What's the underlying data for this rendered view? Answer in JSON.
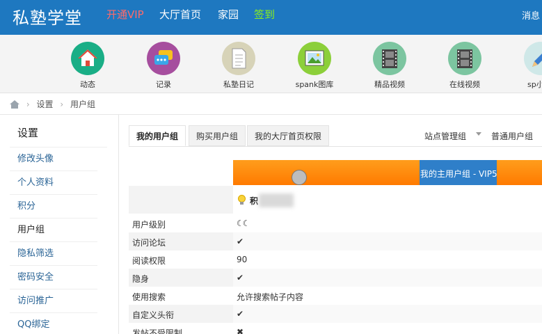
{
  "header": {
    "logo": "私塾学堂",
    "nav": {
      "vip": "开通VIP",
      "hall": "大厅首页",
      "home": "家园",
      "checkin": "签到",
      "messages": "消息"
    }
  },
  "iconbar": {
    "items": [
      {
        "label": "动态",
        "icon": "house-icon",
        "color": "#1aae86"
      },
      {
        "label": "记录",
        "icon": "chat-bubble-icon",
        "color": "#a64e9e"
      },
      {
        "label": "私塾日记",
        "icon": "document-icon",
        "color": "#d7d3b8"
      },
      {
        "label": "spank图库",
        "icon": "picture-icon",
        "color": "#8ccf3a"
      },
      {
        "label": "精品视频",
        "icon": "film-icon",
        "color": "#7cc5a0"
      },
      {
        "label": "在线视频",
        "icon": "film-icon",
        "color": "#7cc5a0"
      },
      {
        "label": "sp小",
        "icon": "pencil-icon",
        "color": "#cfe8e8"
      }
    ]
  },
  "breadcrumb": {
    "items": [
      "设置",
      "用户组"
    ]
  },
  "sidebar": {
    "title": "设置",
    "items": [
      {
        "label": "修改头像"
      },
      {
        "label": "个人资料"
      },
      {
        "label": "积分"
      },
      {
        "label": "用户组"
      },
      {
        "label": "隐私筛选"
      },
      {
        "label": "密码安全"
      },
      {
        "label": "访问推广"
      },
      {
        "label": "QQ绑定"
      }
    ],
    "active": "用户组"
  },
  "tabs": {
    "items": [
      {
        "label": "我的用户组"
      },
      {
        "label": "购买用户组"
      },
      {
        "label": "我的大厅首页权限"
      }
    ],
    "active": "我的用户组",
    "right": {
      "site_admin": "站点管理组",
      "normal_group": "普通用户组"
    }
  },
  "group": {
    "banner_label": "我的主用户组 - VIP5",
    "points_label": "积"
  },
  "permissions": {
    "rows": [
      {
        "label": "用户级别",
        "type": "moons",
        "value": "☾☾"
      },
      {
        "label": "访问论坛",
        "type": "check",
        "value": "✔"
      },
      {
        "label": "阅读权限",
        "type": "text",
        "value": "90"
      },
      {
        "label": "隐身",
        "type": "check",
        "value": "✔"
      },
      {
        "label": "使用搜索",
        "type": "text",
        "value": "允许搜索帖子内容"
      },
      {
        "label": "自定义头衔",
        "type": "check",
        "value": "✔"
      },
      {
        "label": "发帖不受限制",
        "type": "cross",
        "value": "✖"
      }
    ]
  },
  "colors": {
    "topbar": "#1e78c0",
    "vip": "#ff6a6a",
    "checkin": "#8cf01a",
    "banner_orange": "#ff8a0a",
    "banner_blue": "#2f7fc9",
    "check": "#5aa81f",
    "cross": "#e03a3a"
  }
}
